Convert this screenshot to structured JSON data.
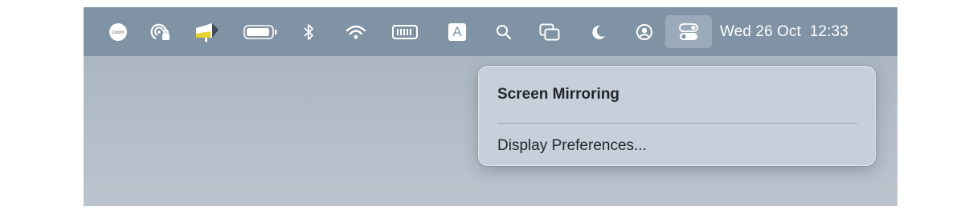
{
  "menubar": {
    "icons": [
      {
        "name": "zoom-icon",
        "text": "zoom"
      },
      {
        "name": "vpn-lock-icon"
      },
      {
        "name": "screen-app-icon"
      },
      {
        "name": "battery-icon"
      },
      {
        "name": "bluetooth-icon"
      },
      {
        "name": "wifi-icon"
      },
      {
        "name": "keyboard-icon"
      },
      {
        "name": "input-source-icon",
        "text": "A"
      },
      {
        "name": "search-icon"
      },
      {
        "name": "screen-mirroring-icon"
      },
      {
        "name": "focus-moon-icon"
      },
      {
        "name": "user-account-icon"
      },
      {
        "name": "control-center-icon"
      }
    ],
    "clock": "Wed 26 Oct  12:33"
  },
  "popup": {
    "title": "Screen Mirroring",
    "item": "Display Preferences..."
  },
  "colors": {
    "menubar": "#7f93a4",
    "popup_bg": "#c6d0da",
    "desktop": "#aeb9c4"
  }
}
